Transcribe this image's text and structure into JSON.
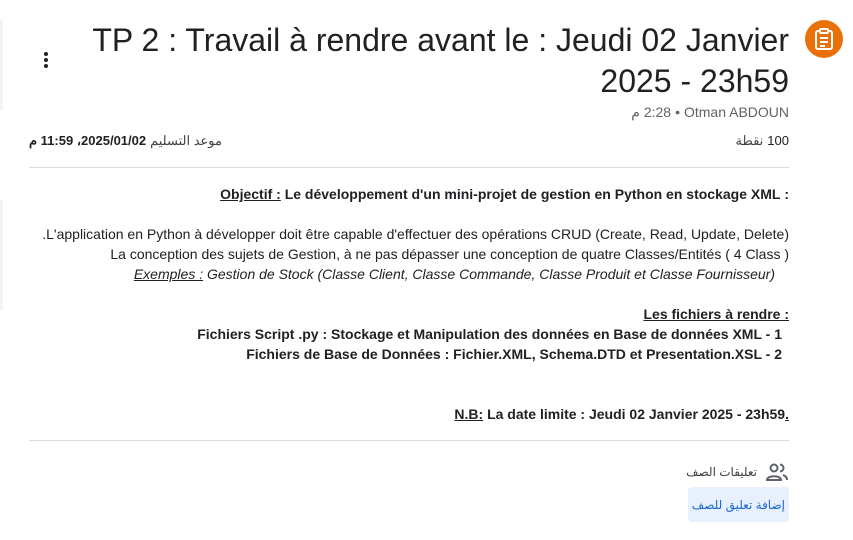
{
  "assignment": {
    "title": "TP 2 : Travail à rendre avant le : Jeudi 02 Janvier 2025 - 23h59",
    "author": "Otman ABDOUN",
    "separator": "•",
    "posted_time": "2:28 م",
    "points_value": "100",
    "points_label": "نقطة",
    "due_label": "موعد التسليم",
    "due_date": "2025/01/02، 11:59 م"
  },
  "description": {
    "objective_label": "Objectif :",
    "objective_prefix": ":",
    "objective_text": "Le développement d'un mini-projet de gestion en Python en stockage XML",
    "line_crud": "L'application en Python à développer doit être capable d'effectuer des opérations CRUD (Create, Read, Update, Delete).",
    "line_conception": "La conception des sujets de Gestion, à ne pas dépasser une conception de quatre Classes/Entités ( 4 Class )",
    "examples_label": "Exemples :",
    "examples_text": "Gestion de Stock (Classe Client, Classe Commande, Classe Produit et Classe Fournisseur)",
    "files_heading": ": Les fichiers à rendre",
    "file1": "Fichiers Script .py : Stockage et Manipulation des données en Base de données XML - 1",
    "file2": "Fichiers de Base de Données : Fichier.XML, Schema.DTD et Presentation.XSL - 2",
    "nb_label": ".N.B:",
    "nb_text": "La date limite : Jeudi 02 Janvier 2025 - 23h59"
  },
  "comments": {
    "header": "تعليقات الصف",
    "add_button": "إضافة تعليق للصف"
  },
  "colors": {
    "accent_orange": "#e8710a",
    "link_blue": "#1967d2",
    "button_bg": "#e8f0fe"
  },
  "icons": {
    "assignment": "assignment-icon",
    "more": "more-vert-icon",
    "people": "people-icon"
  }
}
